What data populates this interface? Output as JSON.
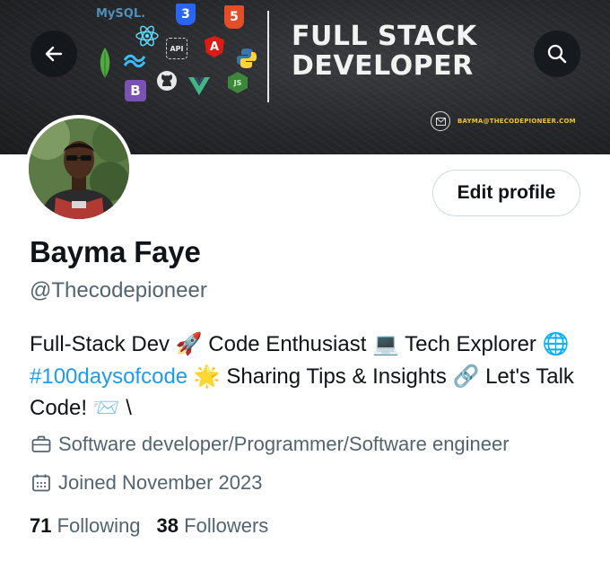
{
  "banner": {
    "title_line1": "FULL STACK",
    "title_line2": "DEVELOPER",
    "email": "BAYMA@THECODEPIONEER.COM",
    "logos": {
      "mysql": "MySQL.",
      "html": "5",
      "angular": "A",
      "bootstrap": "B",
      "vue": "V",
      "node": "JS",
      "api": "API"
    },
    "accent_email_color": "#f0c430"
  },
  "actions": {
    "edit_profile_label": "Edit profile",
    "back_icon": "arrow-left-icon",
    "search_icon": "search-icon"
  },
  "profile": {
    "name": "Bayma Faye",
    "handle": "@Thecodepioneer",
    "bio": {
      "p1": "Full-Stack Dev ",
      "e1": "🚀",
      "p2": " Code Enthusiast ",
      "e2": "💻",
      "p3": " Tech Explorer ",
      "e3": "🌐",
      "p4": " ",
      "hashtag": "#100daysofcode",
      "p5": " ",
      "e4": "🌟",
      "p6": " Sharing Tips & Insights ",
      "e5": "🔗",
      "p7": " Let's Talk Code! ",
      "e6": "📨",
      "p8": " \\"
    },
    "job": "Software developer/Programmer/Software engineer",
    "joined": "Joined November 2023",
    "following_count": "71",
    "following_label": "Following",
    "followers_count": "38",
    "followers_label": "Followers"
  },
  "colors": {
    "link": "#1d9bf0",
    "secondary_text": "#536471",
    "primary_text": "#0f1419"
  }
}
